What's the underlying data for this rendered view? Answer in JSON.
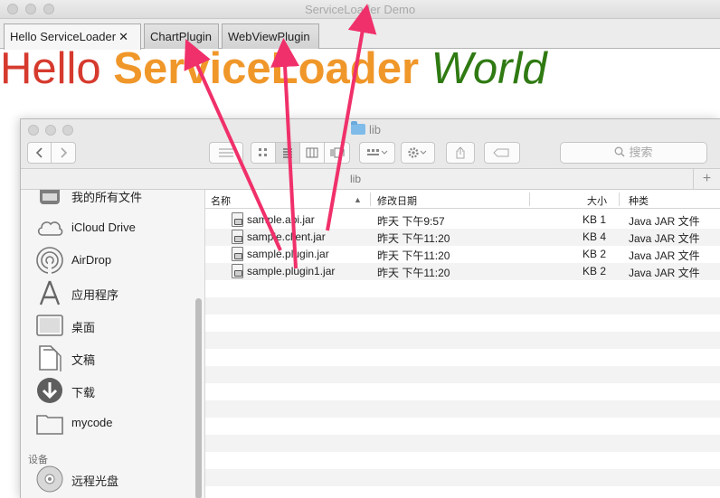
{
  "window": {
    "title": "ServiceLoader Demo"
  },
  "tabs": [
    {
      "label": "Hello ServiceLoader",
      "close": "✕"
    },
    {
      "label": "ChartPlugin"
    },
    {
      "label": "WebViewPlugin"
    }
  ],
  "hello": {
    "word1": "Hello",
    "word2": "ServiceLoader",
    "word3": "World"
  },
  "colors": {
    "hello": "#d63a2e",
    "serviceloader": "#f0972a",
    "world": "#2f7a12",
    "arrow": "#f0306a"
  },
  "finder": {
    "title": "lib",
    "path": "lib",
    "plus": "+",
    "search_placeholder": "搜索",
    "toolbar_icons": [
      "back-icon",
      "forward-icon",
      "list-options-icon",
      "icon-view-icon",
      "list-view-icon",
      "column-view-icon",
      "coverflow-view-icon",
      "arrange-icon",
      "gear-icon",
      "share-icon",
      "tag-icon",
      "search-icon"
    ],
    "sidebar": {
      "items": [
        {
          "label": "我的所有文件",
          "icon": "all-files-icon"
        },
        {
          "label": "iCloud Drive",
          "icon": "cloud-icon"
        },
        {
          "label": "AirDrop",
          "icon": "airdrop-icon"
        },
        {
          "label": "应用程序",
          "icon": "applications-icon"
        },
        {
          "label": "桌面",
          "icon": "desktop-icon"
        },
        {
          "label": "文稿",
          "icon": "documents-icon"
        },
        {
          "label": "下载",
          "icon": "download-icon"
        },
        {
          "label": "mycode",
          "icon": "folder-icon"
        }
      ],
      "section_devices": "设备",
      "device_items": [
        {
          "label": "远程光盘",
          "icon": "disc-icon"
        }
      ]
    },
    "columns": {
      "name": "名称",
      "sort": "▲",
      "date": "修改日期",
      "size": "大小",
      "kind": "种类"
    },
    "files": [
      {
        "name": "sample.api.jar",
        "date": "昨天 下午9:57",
        "size": "1 KB",
        "kind": "Java JAR 文件"
      },
      {
        "name": "sample.client.jar",
        "date": "昨天 下午11:20",
        "size": "4 KB",
        "kind": "Java JAR 文件"
      },
      {
        "name": "sample.plugin.jar",
        "date": "昨天 下午11:20",
        "size": "2 KB",
        "kind": "Java JAR 文件"
      },
      {
        "name": "sample.plugin1.jar",
        "date": "昨天 下午11:20",
        "size": "2 KB",
        "kind": "Java JAR 文件"
      }
    ]
  }
}
